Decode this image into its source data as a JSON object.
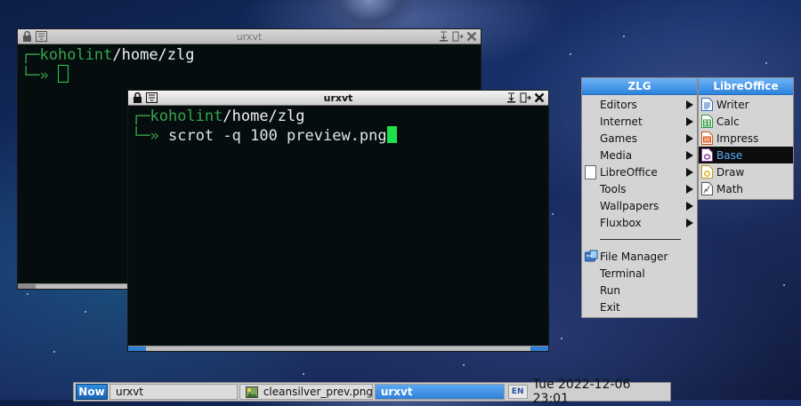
{
  "windows": {
    "back": {
      "title": "urxvt",
      "prompt_host": "koholint",
      "prompt_path": "/home/zlg",
      "prompt_glyph": "»"
    },
    "front": {
      "title": "urxvt",
      "prompt_host": "koholint",
      "prompt_path": "/home/zlg",
      "prompt_glyph": "»",
      "command": "scrot -q 100 preview.png"
    }
  },
  "menu": {
    "title": "ZLG",
    "items": [
      {
        "label": "Editors",
        "submenu": true
      },
      {
        "label": "Internet",
        "submenu": true
      },
      {
        "label": "Games",
        "submenu": true
      },
      {
        "label": "Media",
        "submenu": true
      },
      {
        "label": "LibreOffice",
        "submenu": true,
        "icon": "document-icon"
      },
      {
        "label": "Tools",
        "submenu": true
      },
      {
        "label": "Wallpapers",
        "submenu": true
      },
      {
        "label": "Fluxbox",
        "submenu": true
      },
      {
        "label": "File Manager",
        "icon": "file-manager-icon"
      },
      {
        "label": "Terminal"
      },
      {
        "label": "Run"
      },
      {
        "label": "Exit"
      }
    ]
  },
  "submenu": {
    "title": "LibreOffice",
    "items": [
      {
        "label": "Writer",
        "icon": "writer-icon",
        "color": "#2d6fc4"
      },
      {
        "label": "Calc",
        "icon": "calc-icon",
        "color": "#2f9a3c"
      },
      {
        "label": "Impress",
        "icon": "impress-icon",
        "color": "#d3541e"
      },
      {
        "label": "Base",
        "icon": "base-icon",
        "color": "#8b3a9e",
        "selected": true
      },
      {
        "label": "Draw",
        "icon": "draw-icon",
        "color": "#e0b020"
      },
      {
        "label": "Math",
        "icon": "math-icon",
        "color": "#555555"
      }
    ]
  },
  "taskbar": {
    "workspace": "Now",
    "tasks": [
      {
        "label": "urxvt"
      },
      {
        "label": "cleansilver_prev.png",
        "icon": "image-viewer-icon"
      },
      {
        "label": "urxvt",
        "active": true
      }
    ],
    "keyboard_layout": "EN",
    "clock": "Tue 2022-12-06 23:01"
  },
  "colors": {
    "accent": "#2f7fd6",
    "terminal_bg": "#050d0e",
    "prompt_green": "#3aa350",
    "cursor_green": "#1ee24a"
  }
}
